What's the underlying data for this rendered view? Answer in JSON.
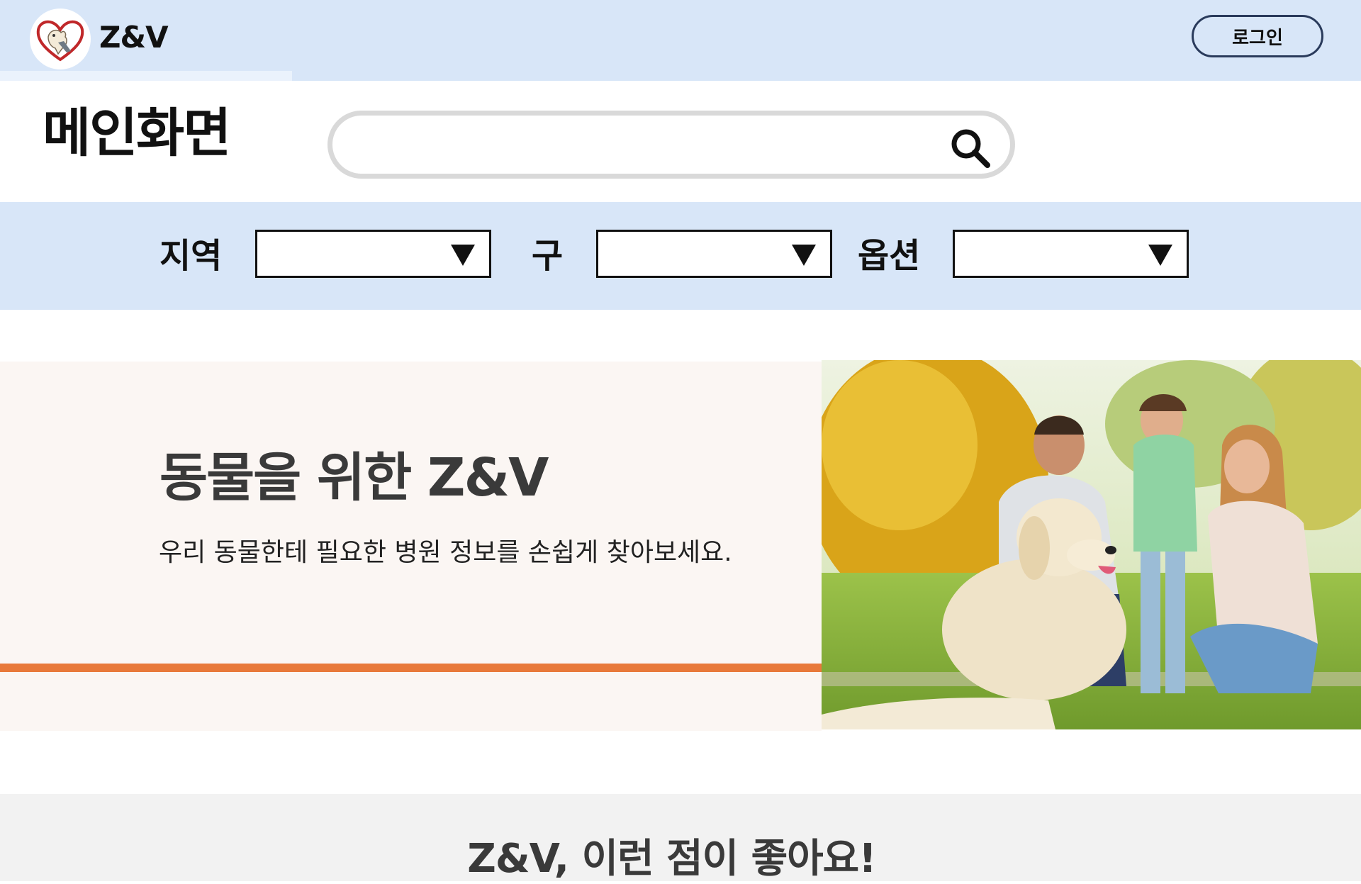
{
  "header": {
    "brand": "Z&V",
    "login_label": "로그인",
    "logo_icon": "heart-dog-logo-icon"
  },
  "page": {
    "title": "메인화면"
  },
  "search": {
    "value": "",
    "placeholder": "",
    "icon": "search-icon"
  },
  "filters": [
    {
      "label": "지역",
      "value": ""
    },
    {
      "label": "구",
      "value": ""
    },
    {
      "label": "옵션",
      "value": ""
    }
  ],
  "hero": {
    "heading": "동물을 위한 Z&V",
    "subtext": "우리 동물한테 필요한 병원 정보를 손쉽게 찾아보세요.",
    "image": "family-with-golden-retriever-photo",
    "accent_line_color": "#e8793a"
  },
  "features": {
    "title": "Z&V, 이런 점이 좋아요!"
  },
  "colors": {
    "header_bg": "#d8e6f8",
    "hero_bg": "#fbf6f3",
    "features_bg": "#f2f2f2",
    "login_border": "#2a3b5c"
  }
}
